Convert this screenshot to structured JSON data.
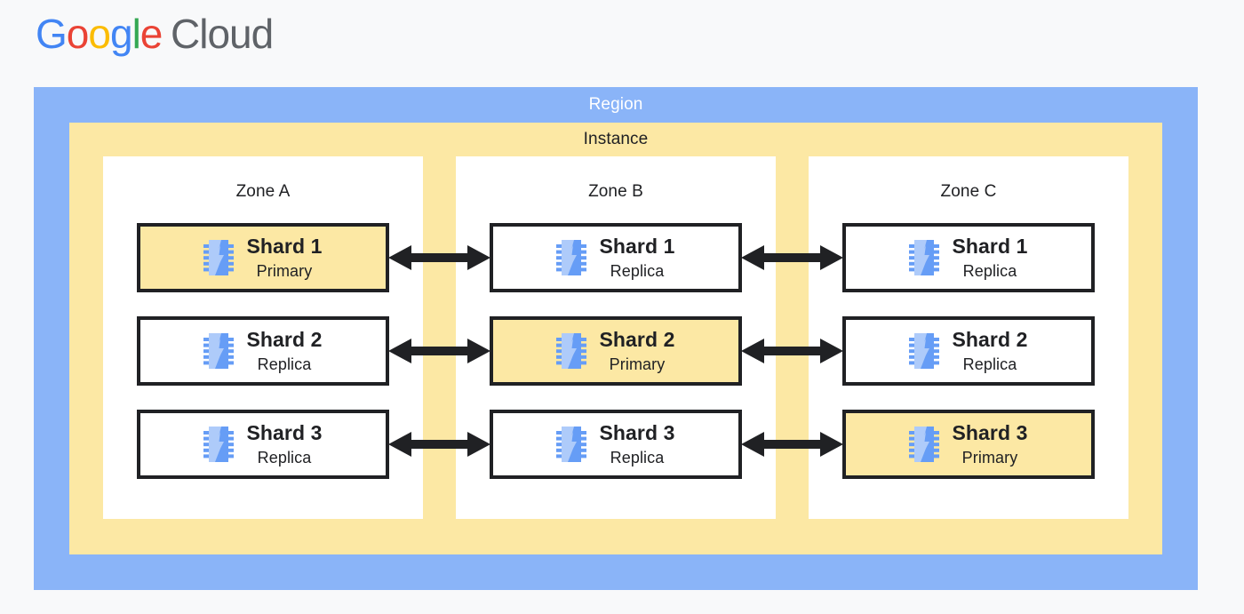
{
  "brand": {
    "name": "Google Cloud",
    "google_letters": [
      "G",
      "o",
      "o",
      "g",
      "l",
      "e"
    ],
    "suffix": "Cloud",
    "colors": {
      "blue": "#4285F4",
      "red": "#EA4335",
      "yellow": "#FBBC04",
      "green": "#34A853",
      "grey": "#5F6368"
    }
  },
  "diagram": {
    "region_label": "Region",
    "instance_label": "Instance",
    "colors": {
      "region_bg": "#8ab4f8",
      "instance_bg": "#fce8a4",
      "zone_bg": "#ffffff",
      "card_border": "#202124",
      "primary_bg": "#fce8a4",
      "replica_bg": "#ffffff",
      "icon_light": "#aecbfa",
      "icon_dark": "#669df6",
      "page_bg": "#f8f9fa"
    },
    "icon_name": "shard-chip-icon",
    "zones": [
      {
        "label": "Zone A",
        "cards": [
          {
            "title": "Shard 1",
            "role": "Primary",
            "state": "primary"
          },
          {
            "title": "Shard 2",
            "role": "Replica",
            "state": "replica"
          },
          {
            "title": "Shard 3",
            "role": "Replica",
            "state": "replica"
          }
        ]
      },
      {
        "label": "Zone B",
        "cards": [
          {
            "title": "Shard 1",
            "role": "Replica",
            "state": "replica"
          },
          {
            "title": "Shard 2",
            "role": "Primary",
            "state": "primary"
          },
          {
            "title": "Shard 3",
            "role": "Replica",
            "state": "replica"
          }
        ]
      },
      {
        "label": "Zone C",
        "cards": [
          {
            "title": "Shard 1",
            "role": "Replica",
            "state": "replica"
          },
          {
            "title": "Shard 2",
            "role": "Replica",
            "state": "replica"
          },
          {
            "title": "Shard 3",
            "role": "Primary",
            "state": "primary"
          }
        ]
      }
    ],
    "connectors": [
      {
        "from": "Zone A",
        "to": "Zone B",
        "row": "Shard 1",
        "direction": "bidirectional"
      },
      {
        "from": "Zone A",
        "to": "Zone B",
        "row": "Shard 2",
        "direction": "bidirectional"
      },
      {
        "from": "Zone A",
        "to": "Zone B",
        "row": "Shard 3",
        "direction": "bidirectional"
      },
      {
        "from": "Zone B",
        "to": "Zone C",
        "row": "Shard 1",
        "direction": "bidirectional"
      },
      {
        "from": "Zone B",
        "to": "Zone C",
        "row": "Shard 2",
        "direction": "bidirectional"
      },
      {
        "from": "Zone B",
        "to": "Zone C",
        "row": "Shard 3",
        "direction": "bidirectional"
      }
    ]
  }
}
